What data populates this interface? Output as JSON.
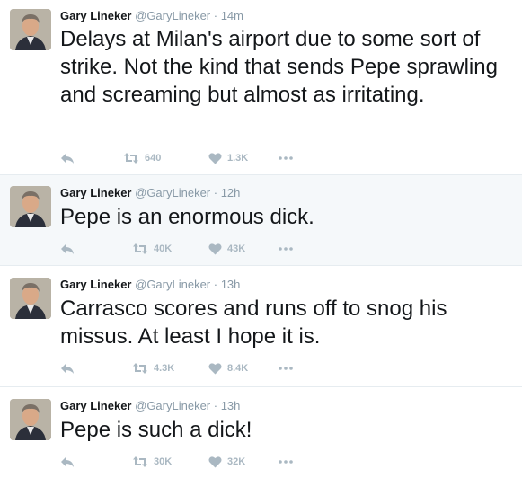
{
  "tweets": [
    {
      "name": "Gary Lineker",
      "handle": "@GaryLineker",
      "time": "· 14m",
      "text": "Delays at Milan's airport due to some sort of strike. Not the kind that sends Pepe sprawling and screaming but almost as irritating.",
      "retweets": "640",
      "likes": "1.3K",
      "highlighted": false
    },
    {
      "name": "Gary Lineker",
      "handle": "@GaryLineker",
      "time": "· 12h",
      "text": "Pepe is an enormous dick.",
      "retweets": "40K",
      "likes": "43K",
      "highlighted": true
    },
    {
      "name": "Gary Lineker",
      "handle": "@GaryLineker",
      "time": "· 13h",
      "text": "Carrasco scores and runs off to snog his missus. At least I hope it is.",
      "retweets": "4.3K",
      "likes": "8.4K",
      "highlighted": false
    },
    {
      "name": "Gary Lineker",
      "handle": "@GaryLineker",
      "time": "· 13h",
      "text": "Pepe is such a dick!",
      "retweets": "30K",
      "likes": "32K",
      "highlighted": false
    }
  ],
  "colors": {
    "text": "#14171a",
    "muted": "#8899a6",
    "icon": "#aab8c2",
    "highlight_bg": "#f5f8fa",
    "divider": "#e6ecf0"
  },
  "icons": {
    "reply": "reply-icon",
    "retweet": "retweet-icon",
    "like": "heart-icon",
    "more": "more-dots-icon"
  }
}
